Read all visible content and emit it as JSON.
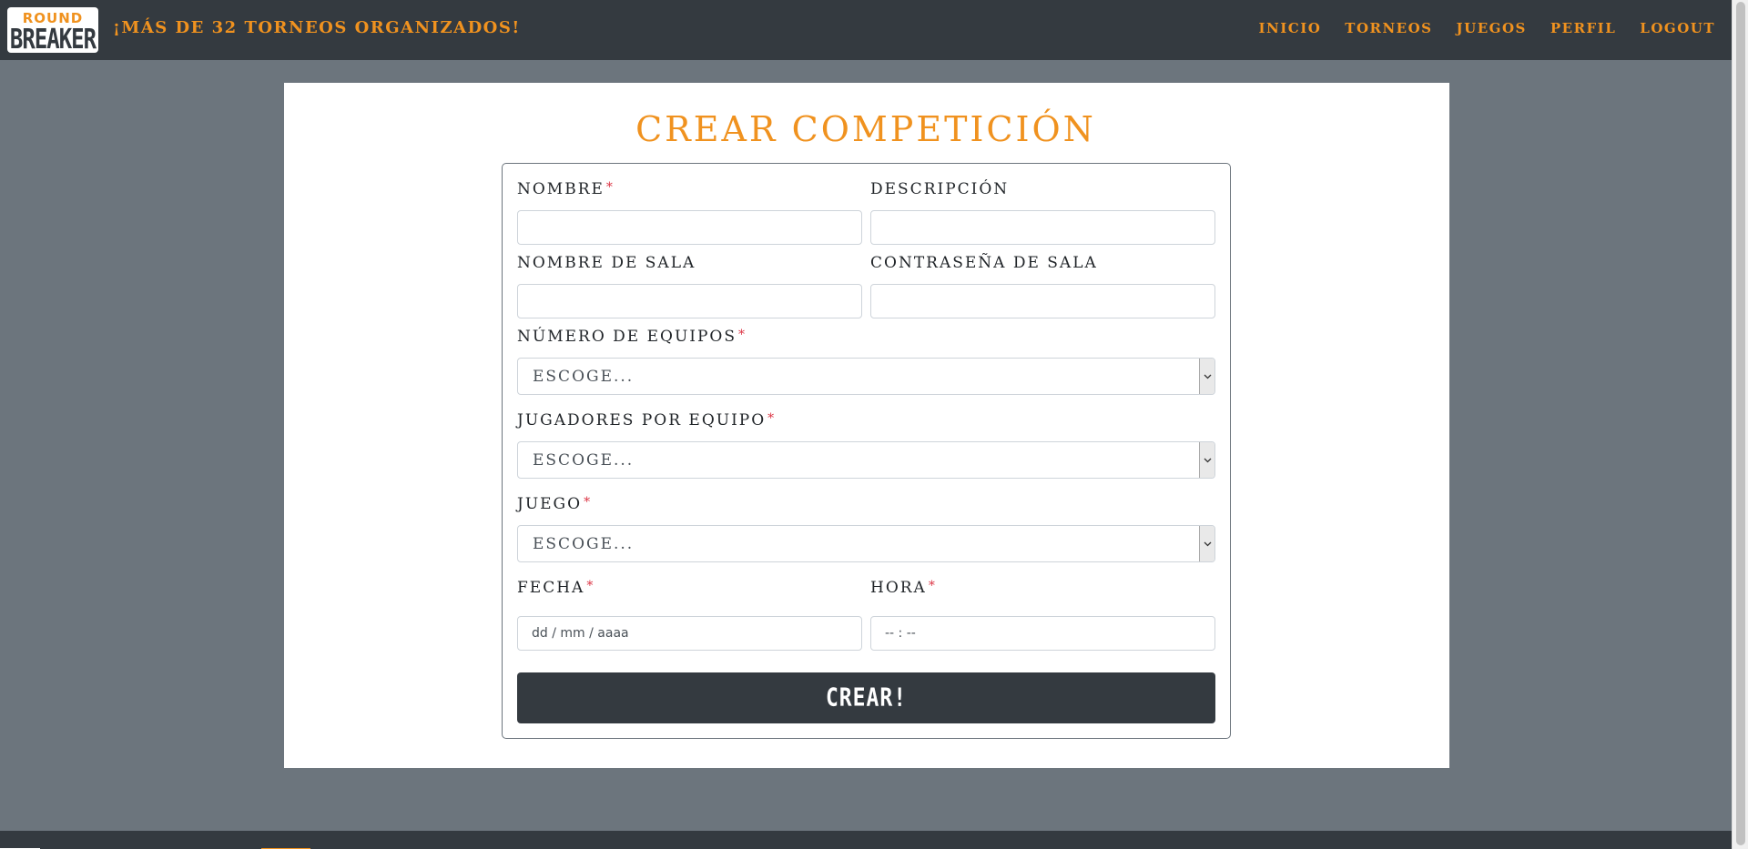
{
  "navbar": {
    "logo_top": "ROUND",
    "logo_bottom": "BREAKER",
    "tagline": "¡MÁS DE 32 TORNEOS ORGANIZADOS!",
    "links": [
      "INICIO",
      "TORNEOS",
      "JUEGOS",
      "PERFIL",
      "LOGOUT"
    ]
  },
  "form": {
    "title": "CREAR COMPETICIÓN",
    "required_mark": "*",
    "fields": {
      "nombre": {
        "label": "NOMBRE",
        "value": "",
        "required": true
      },
      "descripcion": {
        "label": "DESCRIPCIÓN",
        "value": "",
        "required": false
      },
      "nombre_sala": {
        "label": "NOMBRE DE SALA",
        "value": "",
        "required": false
      },
      "password_sala": {
        "label": "CONTRASEÑA DE SALA",
        "value": "",
        "required": false
      },
      "num_equipos": {
        "label": "NÚMERO DE EQUIPOS",
        "selected": "ESCOGE...",
        "required": true
      },
      "jugadores_equipo": {
        "label": "JUGADORES POR EQUIPO",
        "selected": "ESCOGE...",
        "required": true
      },
      "juego": {
        "label": "JUEGO",
        "selected": "ESCOGE...",
        "required": true
      },
      "fecha": {
        "label": "FECHA",
        "placeholder": "dd / mm / aaaa",
        "required": true
      },
      "hora": {
        "label": "HORA",
        "placeholder": "-- : --",
        "required": true
      }
    },
    "submit_label": "CREAR!"
  },
  "colors": {
    "accent": "#f0921f",
    "navbar_bg": "#343a40",
    "page_bg": "#6c757d",
    "required": "#dc3545"
  }
}
